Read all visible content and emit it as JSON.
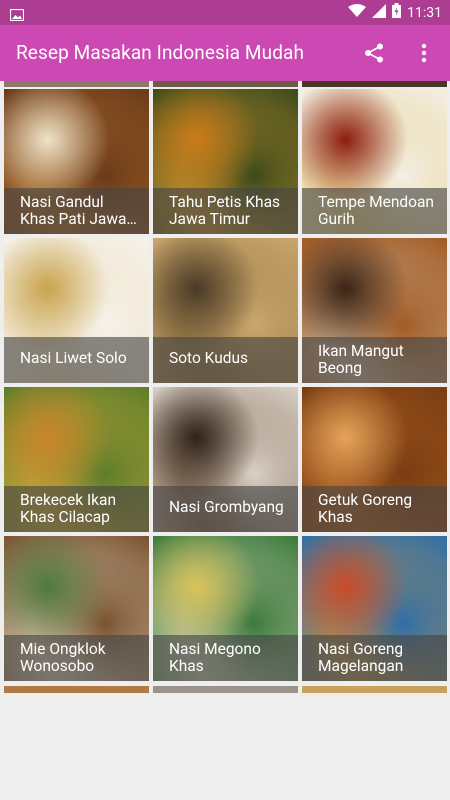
{
  "status_bar": {
    "time": "11:31"
  },
  "app_bar": {
    "title": "Resep Masakan Indonesia Mudah"
  },
  "recipes": [
    {
      "name": "Nasi Gandul Khas Pati Jawa Tengah",
      "colors": [
        "#b9782d",
        "#6b3a1a",
        "#efe3c8"
      ]
    },
    {
      "name": "Tahu Petis Khas Jawa Timur",
      "colors": [
        "#e9a537",
        "#3b4a1a",
        "#c87a18"
      ]
    },
    {
      "name": "Tempe Mendoan Gurih",
      "colors": [
        "#e3c66a",
        "#f3efe6",
        "#8c1d10"
      ]
    },
    {
      "name": "Nasi Liwet Solo",
      "colors": [
        "#e9d6b0",
        "#f6f2ea",
        "#c8a44d"
      ]
    },
    {
      "name": "Soto Kudus",
      "colors": [
        "#8a6a3c",
        "#c9a66b",
        "#4a3b25"
      ]
    },
    {
      "name": "Ikan Mangut Beong",
      "colors": [
        "#d7c7b3",
        "#a25b24",
        "#3a2414"
      ]
    },
    {
      "name": "Brekecek Ikan Khas Cilacap",
      "colors": [
        "#e9b43e",
        "#5d7d2a",
        "#c9852a"
      ]
    },
    {
      "name": "Nasi Grombyang",
      "colors": [
        "#6d4a30",
        "#d9d1c7",
        "#2f2218"
      ]
    },
    {
      "name": "Getuk Goreng Khas",
      "colors": [
        "#b86725",
        "#7a3c12",
        "#e5a35a"
      ]
    },
    {
      "name": "Mie Ongklok Wonosobo",
      "colors": [
        "#efe6d2",
        "#7a5330",
        "#4f7a3c"
      ]
    },
    {
      "name": "Nasi Megono Khas",
      "colors": [
        "#eadfc9",
        "#3b7a3c",
        "#d9c35a"
      ]
    },
    {
      "name": "Nasi Goreng Magelangan",
      "colors": [
        "#d99a3a",
        "#2f6fa8",
        "#c84b2a"
      ]
    }
  ]
}
